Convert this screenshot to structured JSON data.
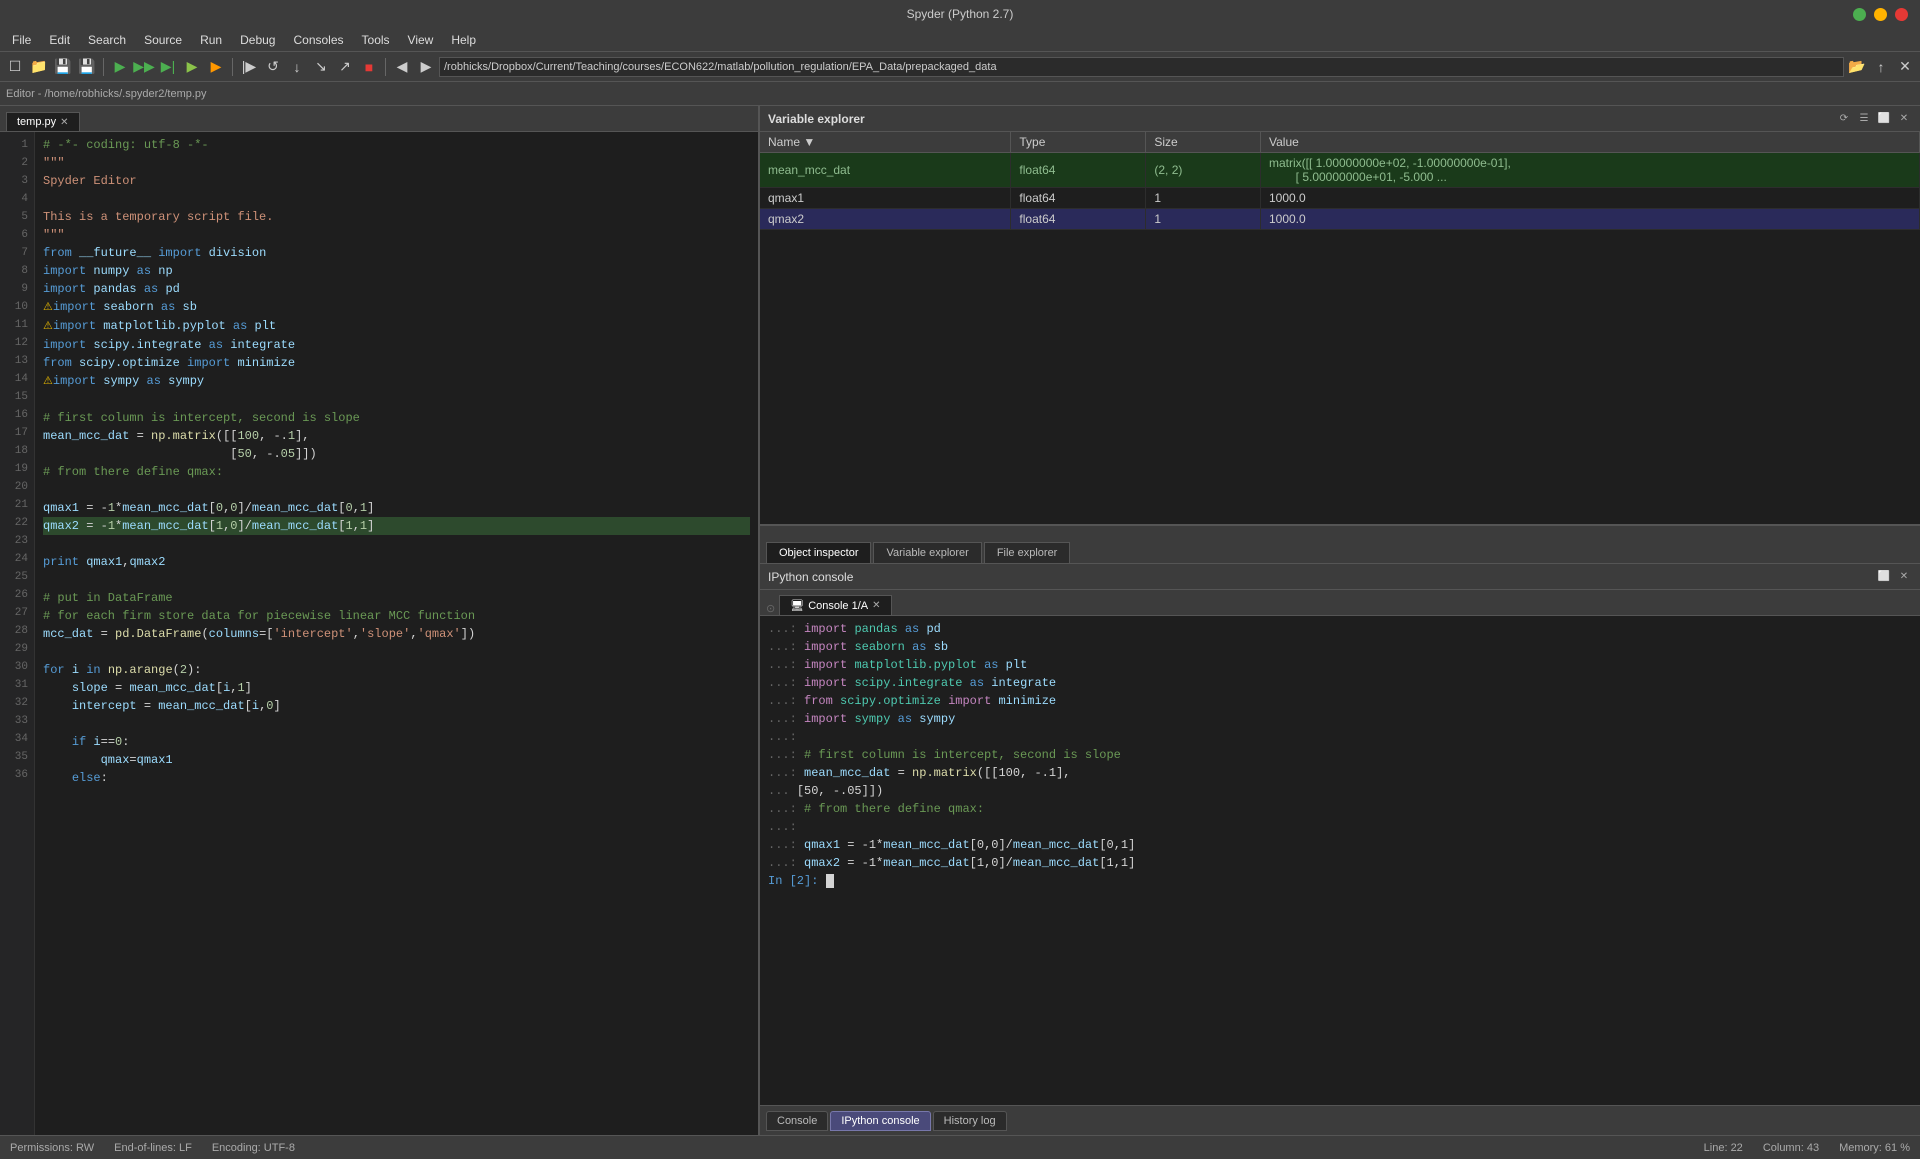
{
  "titleBar": {
    "title": "Spyder (Python 2.7)",
    "buttons": [
      "minimize",
      "maximize",
      "close"
    ]
  },
  "menuBar": {
    "items": [
      "File",
      "Edit",
      "Search",
      "Source",
      "Run",
      "Debug",
      "Consoles",
      "Tools",
      "View",
      "Help"
    ]
  },
  "toolbar": {
    "path": "/robhicks/Dropbox/Current/Teaching/courses/ECON622/matlab/pollution_regulation/EPA_Data/prepackaged_data"
  },
  "editorHeader": {
    "label": "Editor - /home/robhicks/.spyder2/temp.py"
  },
  "editorTabs": [
    {
      "name": "temp.py",
      "closable": true,
      "active": true
    }
  ],
  "code": {
    "lines": [
      {
        "n": 1,
        "content": "# -*- coding: utf-8 -*-",
        "type": "comment"
      },
      {
        "n": 2,
        "content": "\"\"\"",
        "type": "string"
      },
      {
        "n": 3,
        "content": "Spyder Editor",
        "type": "string"
      },
      {
        "n": 4,
        "content": "",
        "type": "normal"
      },
      {
        "n": 5,
        "content": "This is a temporary script file.",
        "type": "string"
      },
      {
        "n": 6,
        "content": "\"\"\"",
        "type": "string"
      },
      {
        "n": 7,
        "content": "from __future__ import division",
        "type": "import"
      },
      {
        "n": 8,
        "content": "import numpy as np",
        "type": "import"
      },
      {
        "n": 9,
        "content": "import pandas as pd",
        "type": "import"
      },
      {
        "n": 10,
        "content": "import seaborn as sb",
        "type": "import",
        "warning": true
      },
      {
        "n": 11,
        "content": "import matplotlib.pyplot as plt",
        "type": "import",
        "warning": true
      },
      {
        "n": 12,
        "content": "import scipy.integrate as integrate",
        "type": "import"
      },
      {
        "n": 13,
        "content": "from scipy.optimize import minimize",
        "type": "import"
      },
      {
        "n": 14,
        "content": "import sympy as sympy",
        "type": "import",
        "warning": true
      },
      {
        "n": 15,
        "content": "",
        "type": "normal"
      },
      {
        "n": 16,
        "content": "# first column is intercept, second is slope",
        "type": "comment"
      },
      {
        "n": 17,
        "content": "mean_mcc_dat = np.matrix([[100, -.1],",
        "type": "code"
      },
      {
        "n": 18,
        "content": "                          [50, -.05]])",
        "type": "code"
      },
      {
        "n": 19,
        "content": "# from there define qmax:",
        "type": "comment"
      },
      {
        "n": 20,
        "content": "",
        "type": "normal"
      },
      {
        "n": 21,
        "content": "qmax1 = -1*mean_mcc_dat[0,0]/mean_mcc_dat[0,1]",
        "type": "code"
      },
      {
        "n": 22,
        "content": "qmax2 = -1*mean_mcc_dat[1,0]/mean_mcc_dat[1,1]",
        "type": "code",
        "highlight": true
      },
      {
        "n": 23,
        "content": "",
        "type": "normal"
      },
      {
        "n": 24,
        "content": "print qmax1,qmax2",
        "type": "code"
      },
      {
        "n": 25,
        "content": "",
        "type": "normal"
      },
      {
        "n": 26,
        "content": "# put in DataFrame",
        "type": "comment"
      },
      {
        "n": 27,
        "content": "# for each firm store data for piecewise linear MCC function",
        "type": "comment"
      },
      {
        "n": 28,
        "content": "mcc_dat = pd.DataFrame(columns=['intercept','slope','qmax'])",
        "type": "code"
      },
      {
        "n": 29,
        "content": "",
        "type": "normal"
      },
      {
        "n": 30,
        "content": "for i in np.arange(2):",
        "type": "code"
      },
      {
        "n": 31,
        "content": "    slope = mean_mcc_dat[i,1]",
        "type": "code"
      },
      {
        "n": 32,
        "content": "    intercept = mean_mcc_dat[i,0]",
        "type": "code"
      },
      {
        "n": 33,
        "content": "",
        "type": "normal"
      },
      {
        "n": 34,
        "content": "    if i==0:",
        "type": "code"
      },
      {
        "n": 35,
        "content": "        qmax=qmax1",
        "type": "code"
      },
      {
        "n": 36,
        "content": "    else:",
        "type": "code"
      }
    ]
  },
  "variableExplorer": {
    "title": "Variable explorer",
    "columns": [
      "Name",
      "▼",
      "Type",
      "Size",
      "Value"
    ],
    "rows": [
      {
        "name": "mean_mcc_dat",
        "type": "float64",
        "size": "(2, 2)",
        "value": "matrix([[  1.00000000e+02,  -1.00000000e-01],\n        [  5.00000000e+01,  -5.000 ...",
        "style": "green"
      },
      {
        "name": "qmax1",
        "type": "float64",
        "size": "1",
        "value": "1000.0",
        "style": "normal"
      },
      {
        "name": "qmax2",
        "type": "float64",
        "size": "1",
        "value": "1000.0",
        "style": "selected"
      }
    ]
  },
  "panelTabs": [
    {
      "label": "Object inspector",
      "active": true
    },
    {
      "label": "Variable explorer",
      "active": false
    },
    {
      "label": "File explorer",
      "active": false
    }
  ],
  "ipythonConsole": {
    "title": "IPython console",
    "consoleTabs": [
      {
        "label": "Console 1/A",
        "active": true,
        "closable": true
      }
    ],
    "output": [
      {
        "type": "continuation",
        "text": "...: import pandas as pd"
      },
      {
        "type": "continuation",
        "text": "...: import seaborn as sb"
      },
      {
        "type": "continuation",
        "text": "...: import matplotlib.pyplot as plt"
      },
      {
        "type": "continuation",
        "text": "...: import scipy.integrate as integrate"
      },
      {
        "type": "continuation",
        "text": "...: from scipy.optimize import minimize"
      },
      {
        "type": "continuation",
        "text": "...: import sympy as sympy"
      },
      {
        "type": "continuation",
        "text": "...:"
      },
      {
        "type": "continuation",
        "text": "...: # first column is intercept, second is slope"
      },
      {
        "type": "continuation",
        "text": "...: mean_mcc_dat = np.matrix([[100, -.1],"
      },
      {
        "type": "continuation",
        "text": "...                           [50, -.05]])"
      },
      {
        "type": "continuation",
        "text": "...: # from there define qmax:"
      },
      {
        "type": "continuation",
        "text": "...:"
      },
      {
        "type": "continuation",
        "text": "...: qmax1 = -1*mean_mcc_dat[0,0]/mean_mcc_dat[0,1]"
      },
      {
        "type": "continuation",
        "text": "...: qmax2 = -1*mean_mcc_dat[1,0]/mean_mcc_dat[1,1]"
      },
      {
        "type": "prompt",
        "text": "In [2]:"
      }
    ],
    "bottomTabs": [
      "Console",
      "IPython console",
      "History log"
    ]
  },
  "statusBar": {
    "permissions": "Permissions: RW",
    "eol": "End-of-lines: LF",
    "encoding": "Encoding: UTF-8",
    "line": "Line: 22",
    "column": "Column: 43",
    "memory": "Memory: 61 %"
  }
}
